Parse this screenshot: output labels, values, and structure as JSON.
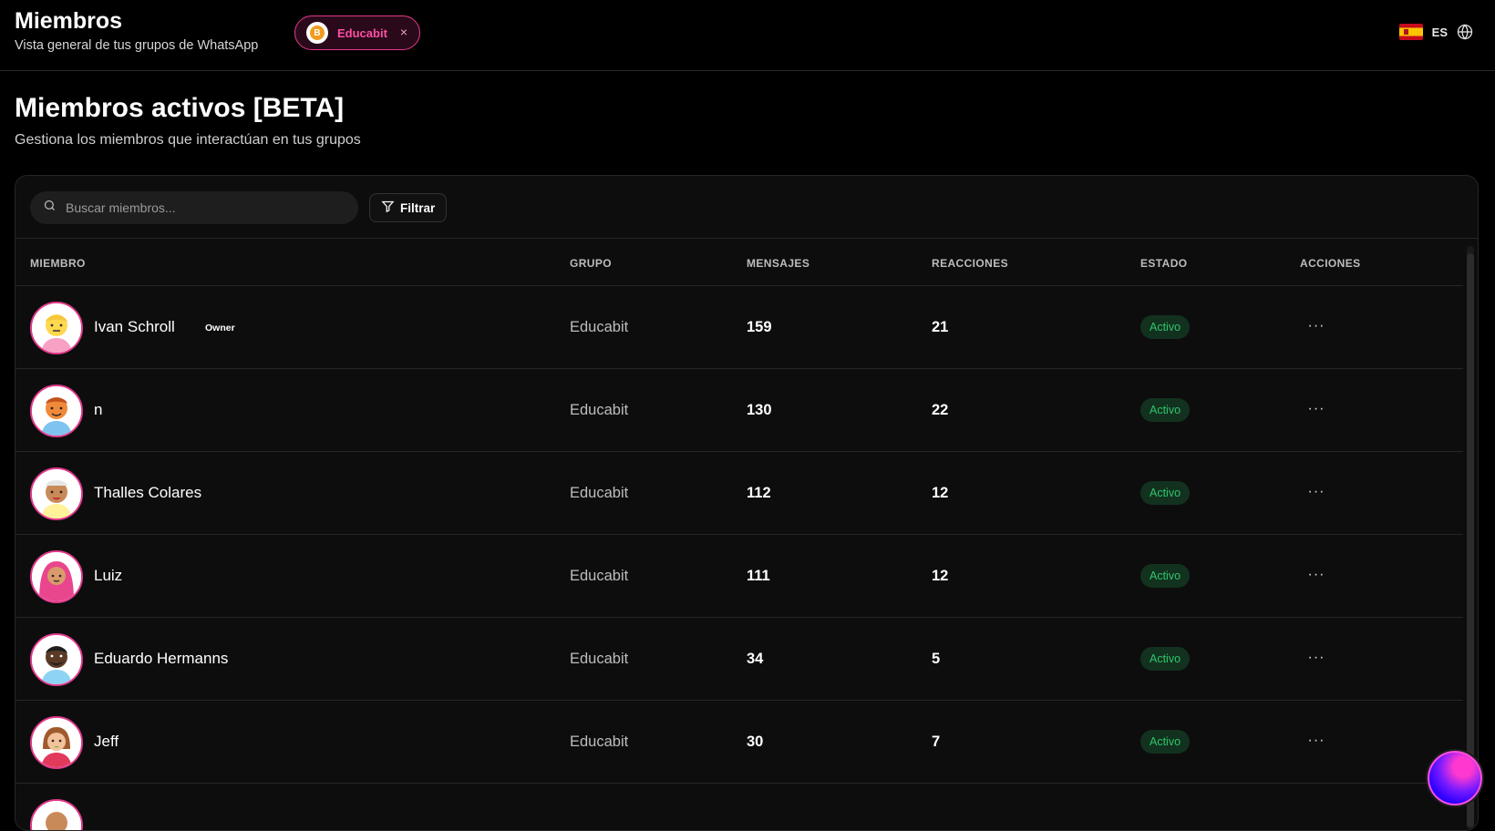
{
  "header": {
    "title": "Miembros",
    "subtitle": "Vista general de tus grupos de WhatsApp",
    "group_chip": {
      "label": "Educabit",
      "close": "×",
      "coin": "B"
    },
    "language": {
      "code": "ES"
    }
  },
  "page": {
    "title": "Miembros activos [BETA]",
    "subtitle": "Gestiona los miembros que interactúan en tus grupos"
  },
  "toolbar": {
    "search_placeholder": "Buscar miembros...",
    "filter_label": "Filtrar"
  },
  "table": {
    "columns": [
      "MIEMBRO",
      "GRUPO",
      "MENSAJES",
      "REACCIONES",
      "ESTADO",
      "ACCIONES"
    ],
    "rows": [
      {
        "name": "Ivan Schroll",
        "tag": "Owner",
        "group": "Educabit",
        "messages": "159",
        "reactions": "21",
        "status": "Activo",
        "actions": "···"
      },
      {
        "name": "n",
        "tag": "",
        "group": "Educabit",
        "messages": "130",
        "reactions": "22",
        "status": "Activo",
        "actions": "···"
      },
      {
        "name": "Thalles Colares",
        "tag": "",
        "group": "Educabit",
        "messages": "112",
        "reactions": "12",
        "status": "Activo",
        "actions": "···"
      },
      {
        "name": "Luiz",
        "tag": "",
        "group": "Educabit",
        "messages": "111",
        "reactions": "12",
        "status": "Activo",
        "actions": "···"
      },
      {
        "name": "Eduardo Hermanns",
        "tag": "",
        "group": "Educabit",
        "messages": "34",
        "reactions": "5",
        "status": "Activo",
        "actions": "···"
      },
      {
        "name": "Jeff",
        "tag": "",
        "group": "Educabit",
        "messages": "30",
        "reactions": "7",
        "status": "Activo",
        "actions": "···"
      },
      {
        "name": "",
        "tag": "",
        "group": "",
        "messages": "",
        "reactions": "",
        "status": "",
        "actions": ""
      }
    ]
  },
  "colors": {
    "accent": "#e23a8c",
    "status_active_bg": "#12321f",
    "status_active_text": "#31c46b"
  },
  "icons": {
    "search": "search-icon",
    "filter": "filter-icon",
    "globe": "globe-icon",
    "flag": "spain-flag-icon",
    "more": "more-horizontal-icon",
    "assistant": "assistant-orb-icon"
  }
}
